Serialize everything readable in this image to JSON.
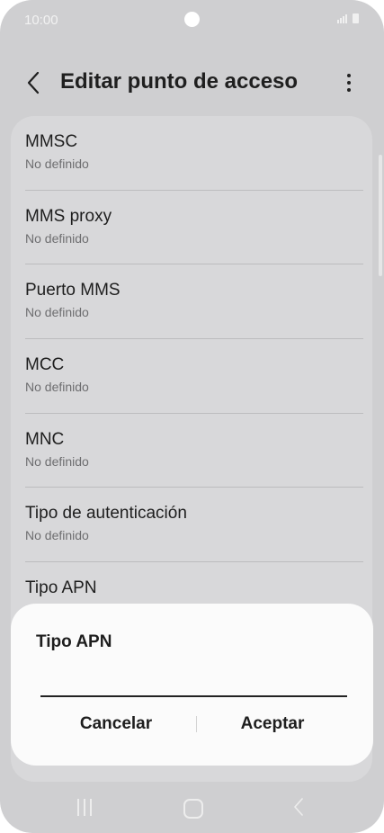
{
  "status": {
    "time": "10:00"
  },
  "appbar": {
    "title": "Editar punto de acceso"
  },
  "list": {
    "items": [
      {
        "title": "MMSC",
        "value": "No definido"
      },
      {
        "title": "MMS proxy",
        "value": "No definido"
      },
      {
        "title": "Puerto MMS",
        "value": "No definido"
      },
      {
        "title": "MCC",
        "value": "No definido"
      },
      {
        "title": "MNC",
        "value": "No definido"
      },
      {
        "title": "Tipo de autenticación",
        "value": "No definido"
      },
      {
        "title": "Tipo APN",
        "value": ""
      }
    ]
  },
  "dialog": {
    "title": "Tipo APN",
    "input_value": "",
    "cancel_label": "Cancelar",
    "accept_label": "Aceptar"
  },
  "icons": {
    "back": "chevron-left-icon",
    "more": "more-vertical-icon",
    "signal": "signal-icon",
    "battery": "battery-icon",
    "nav_recents": "recents-icon",
    "nav_home": "home-icon",
    "nav_back": "back-icon"
  },
  "colors": {
    "background": "#cfcfd1",
    "card": "#d8d8da",
    "dialog": "#fbfbfb",
    "text": "#1e1e1e",
    "subtext": "#6e6e70"
  }
}
